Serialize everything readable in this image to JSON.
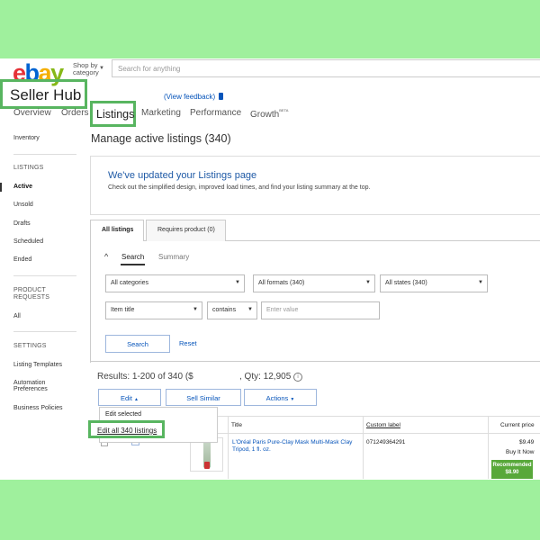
{
  "header": {
    "logo_letters": [
      "e",
      "b",
      "a",
      "y"
    ],
    "shop_by_line1": "Shop by",
    "shop_by_line2": "category",
    "search_placeholder": "Search for anything"
  },
  "seller_hub": {
    "title": "Seller Hub",
    "view_feedback": "(View feedback)"
  },
  "nav": {
    "tabs": [
      "Overview",
      "Orders",
      "Listings",
      "Marketing",
      "Performance",
      "Growth"
    ],
    "growth_badge": "BETA",
    "active_tab": "Listings"
  },
  "sidebar": {
    "inventory": "Inventory",
    "listings_heading": "LISTINGS",
    "listings_items": [
      "Active",
      "Unsold",
      "Drafts",
      "Scheduled",
      "Ended"
    ],
    "active_item": "Active",
    "product_requests_heading_1": "PRODUCT",
    "product_requests_heading_2": "REQUESTS",
    "product_requests_items": [
      "All"
    ],
    "settings_heading": "SETTINGS",
    "settings_items": [
      "Listing Templates",
      "Automation Preferences",
      "Business Policies"
    ],
    "automation_line1": "Automation",
    "automation_line2": "Preferences"
  },
  "main": {
    "title": "Manage active listings (340)",
    "banner_title": "We've updated your Listings page",
    "banner_text": "Check out the simplified design, improved load times, and find your listing summary at the top.",
    "tabs": [
      "All listings",
      "Requires product (0)"
    ],
    "subtabs": [
      "Search",
      "Summary"
    ],
    "filters": {
      "category": "All categories",
      "formats": "All formats (340)",
      "states": "All states (340)",
      "field": "Item title",
      "operator": "contains",
      "value_placeholder": "Enter value"
    },
    "search_button": "Search",
    "reset_link": "Reset",
    "results_text": "Results: 1-200 of 340 ($",
    "qty_text": ", Qty: 12,905",
    "info_glyph": "i",
    "action_buttons": [
      "Edit",
      "Sell Similar",
      "Actions"
    ],
    "edit_menu": [
      "Edit selected",
      "Edit all 340 listings"
    ],
    "table_headers": [
      "Title",
      "Custom label",
      "Current price"
    ],
    "rows": [
      {
        "edit": "Edit",
        "title": "L'Oréal Paris Pure-Clay Mask Multi-Mask Clay Tripod, 1 fl. oz.",
        "custom_label": "071249364291",
        "price": "$9.49",
        "format": "Buy It Now",
        "recommended_label": "Recommended",
        "recommended_price": "$8.90"
      }
    ]
  },
  "colors": {
    "background": "#9ff09d",
    "highlight": "#58b560",
    "link": "#0654ba",
    "recommended": "#58a83a"
  }
}
